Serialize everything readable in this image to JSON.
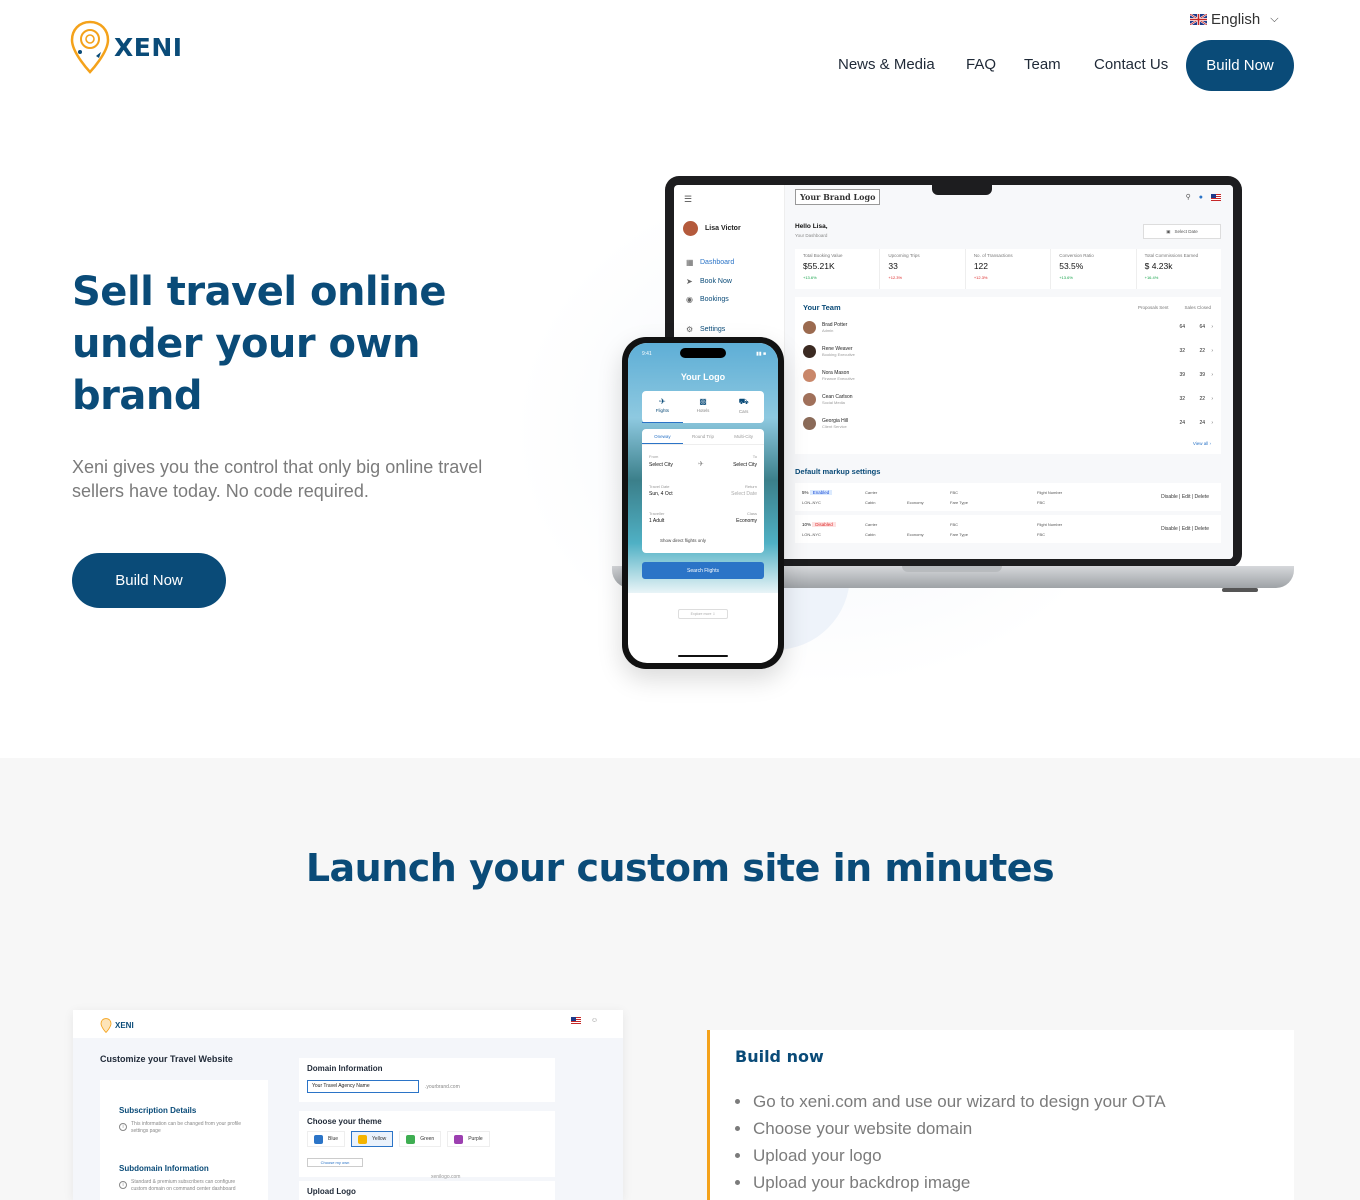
{
  "brand": {
    "name": "XENI",
    "primary_color": "#0a4b78",
    "accent_color": "#f4a21b"
  },
  "header": {
    "language": "English",
    "nav": [
      "News & Media",
      "FAQ",
      "Team",
      "Contact Us"
    ],
    "cta": "Build Now"
  },
  "hero": {
    "title": "Sell travel online under your own brand",
    "subtitle": "Xeni gives you the control that only big online travel sellers have today. No code required.",
    "cta": "Build Now"
  },
  "dashboard": {
    "brand_logo": "Your Brand Logo",
    "user": "Lisa Victor",
    "menu": [
      "Dashboard",
      "Book Now",
      "Bookings",
      "Settings"
    ],
    "greeting": "Hello Lisa,",
    "greeting_sub": "Your Dashboard",
    "select_date": "Select Date",
    "stats": [
      {
        "title": "Total Booking Value",
        "value": "$55.21K",
        "delta": "+13.6%",
        "trend": "up"
      },
      {
        "title": "Upcoming Trips",
        "value": "33",
        "delta": "+12.3%",
        "trend": "down"
      },
      {
        "title": "No. of Transactions",
        "value": "122",
        "delta": "+12.3%",
        "trend": "down"
      },
      {
        "title": "Conversion Ratio",
        "value": "53.5%",
        "delta": "+13.6%",
        "trend": "up"
      },
      {
        "title": "Total Commissions Earned",
        "value": "$ 4.23k",
        "delta": "+16.4%",
        "trend": "up"
      }
    ],
    "team_title": "Your Team",
    "team_cols": [
      "Proposals Sent",
      "Sales Closed"
    ],
    "team": [
      {
        "name": "Brad Potter",
        "role": "Admin",
        "sent": "64",
        "closed": "64"
      },
      {
        "name": "Rene Weaver",
        "role": "Booking Executive",
        "sent": "32",
        "closed": "22"
      },
      {
        "name": "Nora Mason",
        "role": "Finance Executive",
        "sent": "39",
        "closed": "39"
      },
      {
        "name": "Cean Carlson",
        "role": "Social Media",
        "sent": "32",
        "closed": "22"
      },
      {
        "name": "Georgia Hill",
        "role": "Client Service",
        "sent": "24",
        "closed": "24"
      }
    ],
    "view_all": "View all ›",
    "markup_title": "Default markup settings",
    "markups": [
      {
        "pct": "5%",
        "status": "Enabled",
        "route": "LON–NYC",
        "carrier": "Carrier",
        "cabin": "Cabin",
        "cabin_val": "Economy",
        "fbc": "FBC",
        "fare_type": "Fare Type",
        "flight_number": "Flight Number",
        "fbc2": "FBC",
        "actions": "Disable | Edit | Delete"
      },
      {
        "pct": "10%",
        "status": "Disabled",
        "route": "LON–NYC",
        "carrier": "Carrier",
        "cabin": "Cabin",
        "cabin_val": "Economy",
        "fbc": "FBC",
        "fare_type": "Fare Type",
        "flight_number": "Flight Number",
        "fbc2": "FBC",
        "actions": "Disable | Edit | Delete"
      }
    ]
  },
  "phone": {
    "time": "9:41",
    "logo": "Your Logo",
    "tabs": [
      "Flights",
      "Hotels",
      "Cars"
    ],
    "trip_types": [
      "Oneway",
      "Round Trip",
      "Multi-City"
    ],
    "from_label": "From",
    "from_value": "Select City",
    "to_label": "To",
    "to_value": "Select City",
    "travel_label": "Travel Date",
    "travel_value": "Sun, 4 Oct",
    "return_label": "Return",
    "return_value": "Select Date",
    "traveller_label": "Traveller",
    "traveller_value": "1 Adult",
    "class_label": "Class",
    "class_value": "Economy",
    "direct": "Show direct flights only",
    "search": "Search Flights",
    "explore": "Explore more ⇩"
  },
  "section2": {
    "title": "Launch your custom site in minutes",
    "screenshot": {
      "logo": "XENI",
      "heading": "Customize your Travel Website",
      "subscription_title": "Subscription Details",
      "subscription_desc": "This information can be changed from your profile settings page",
      "subdomain_title": "Subdomain Information",
      "subdomain_desc": "Standard & premium subscribers can configure custom domain on command center dashboard",
      "domain_title": "Domain Information",
      "domain_value": "Your Travel Agency Name",
      "domain_suffix": ".yourbrand.com",
      "theme_title": "Choose your theme",
      "themes": [
        {
          "name": "Blue",
          "color": "#2b74c7"
        },
        {
          "name": "Yellow",
          "color": "#f4b400"
        },
        {
          "name": "Green",
          "color": "#3fae52"
        },
        {
          "name": "Purple",
          "color": "#9c3fb0"
        }
      ],
      "own_theme": "Choose my own",
      "logo_url": "xenilogo.com",
      "upload_title": "Upload Logo"
    },
    "build": {
      "title": "Build now",
      "steps": [
        "Go to xeni.com and use our wizard to design your OTA",
        "Choose your website domain",
        "Upload your logo",
        "Upload your backdrop image"
      ]
    }
  }
}
